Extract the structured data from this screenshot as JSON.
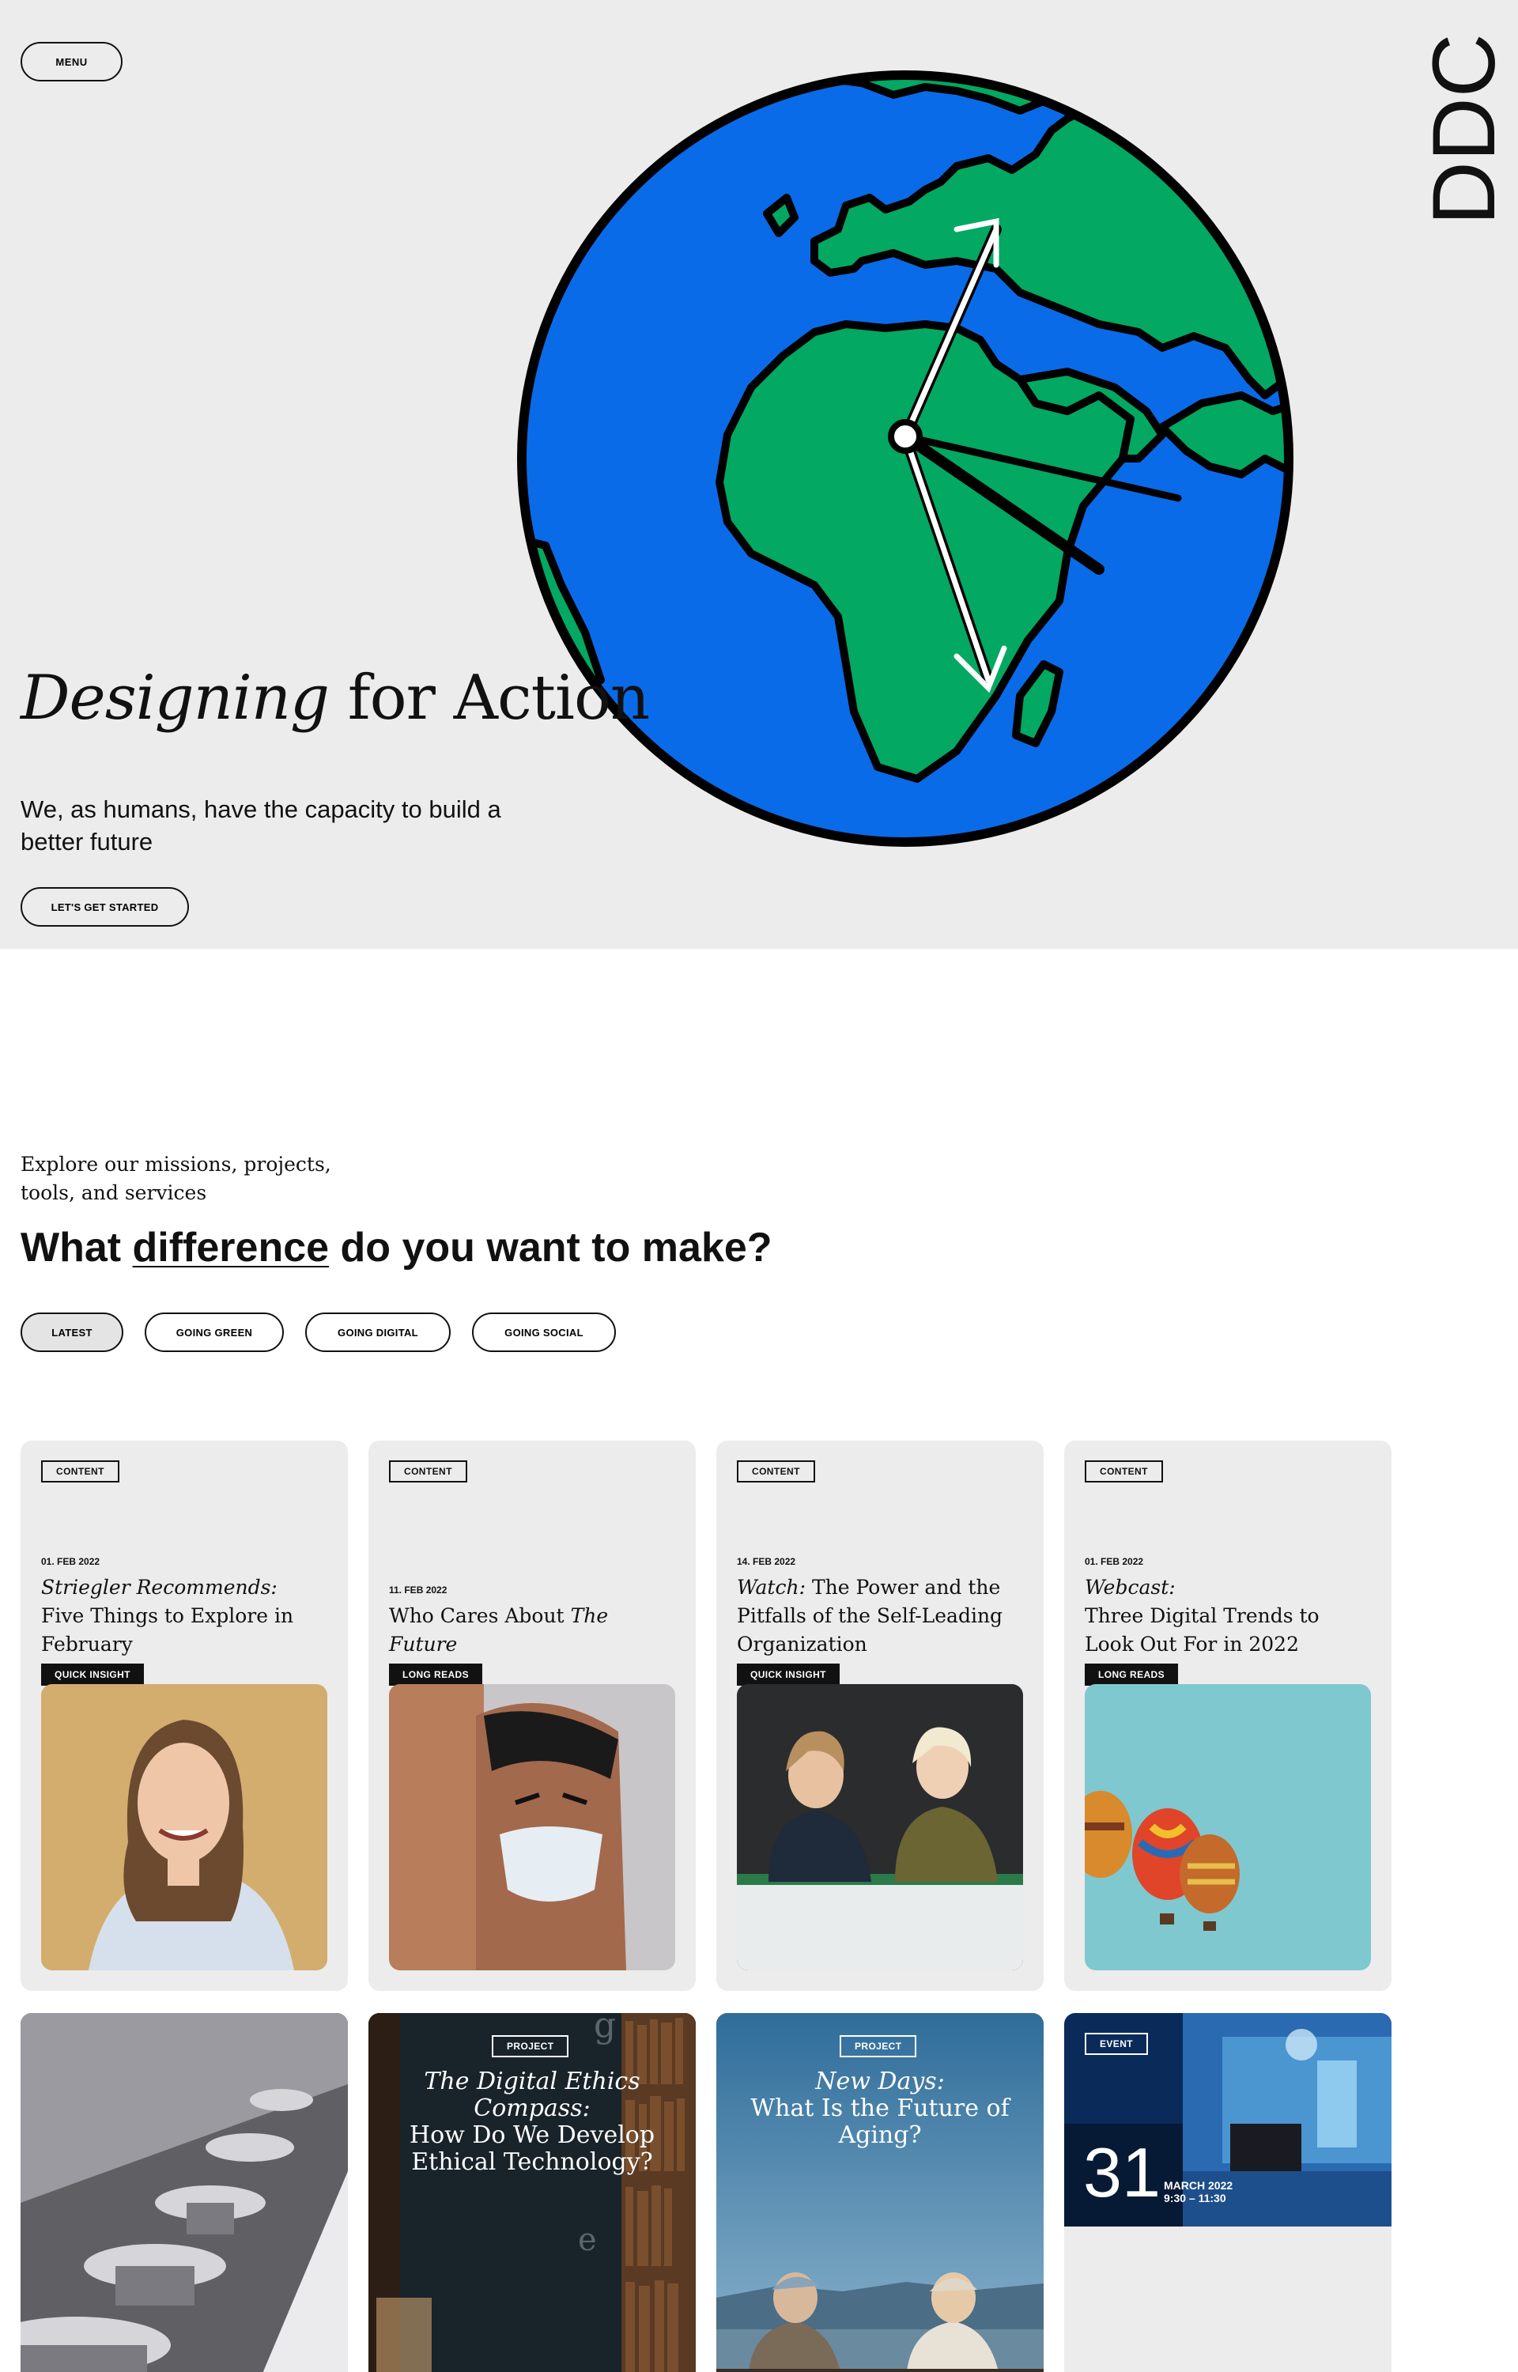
{
  "header": {
    "menu_label": "MENU",
    "logo_text": "DDC"
  },
  "hero": {
    "title_italic": "Designing",
    "title_rest": " for Action",
    "subtitle": "We, as humans, have the capacity to build a better future",
    "cta_label": "LET'S GET STARTED"
  },
  "explore": {
    "intro": "Explore our missions, projects, tools, and services",
    "question_before": "What ",
    "question_underlined": "difference",
    "question_after": " do you want to make?",
    "filters": [
      {
        "label": "LATEST",
        "active": true
      },
      {
        "label": "GOING GREEN",
        "active": false
      },
      {
        "label": "GOING DIGITAL",
        "active": false
      },
      {
        "label": "GOING SOCIAL",
        "active": false
      }
    ]
  },
  "cards": [
    {
      "tag": "CONTENT",
      "date": "01. FEB 2022",
      "title_italic": "Striegler Recommends:",
      "title_rest": "Five Things to Explore in February",
      "badge": "QUICK INSIGHT",
      "image": "portrait-woman-smiling"
    },
    {
      "tag": "CONTENT",
      "date": "11. FEB 2022",
      "title_plain": "Who Cares About ",
      "title_italic_end": "The Future",
      "badge": "LONG READS",
      "image": "spock-poster-with-mask"
    },
    {
      "tag": "CONTENT",
      "date": "14. FEB 2022",
      "title_italic": "Watch:",
      "title_rest": "The Power and the Pitfalls of the Self-Leading Organization",
      "badge": "QUICK INSIGHT",
      "image": "two-women-laughing-at-table"
    },
    {
      "tag": "CONTENT",
      "date": "01. FEB 2022",
      "title_italic": "Webcast:",
      "title_rest": "Three Digital Trends to Look Out For in 2022",
      "badge": "LONG READS",
      "image": "hot-air-balloons"
    }
  ],
  "cards_row2": [
    {
      "image": "metal-discs-machine"
    },
    {
      "tag": "PROJECT",
      "title_italic": "The Digital Ethics Compass:",
      "title_rest": "How Do We Develop Ethical Technology?",
      "image": "library-bookshelves"
    },
    {
      "tag": "PROJECT",
      "title_italic": "New Days:",
      "title_rest": "What Is the Future of Aging?",
      "image": "elderly-couple-on-bench"
    },
    {
      "tag": "EVENT",
      "day": "31",
      "month": "MARCH 2022",
      "time": "9:30 – 11:30",
      "image": "blue-lab-machinery"
    }
  ],
  "colors": {
    "hero_bg": "#ececec",
    "globe_ocean": "#0a6be8",
    "globe_land": "#03a862",
    "card_bg": "#ececec",
    "ink": "#111111"
  }
}
